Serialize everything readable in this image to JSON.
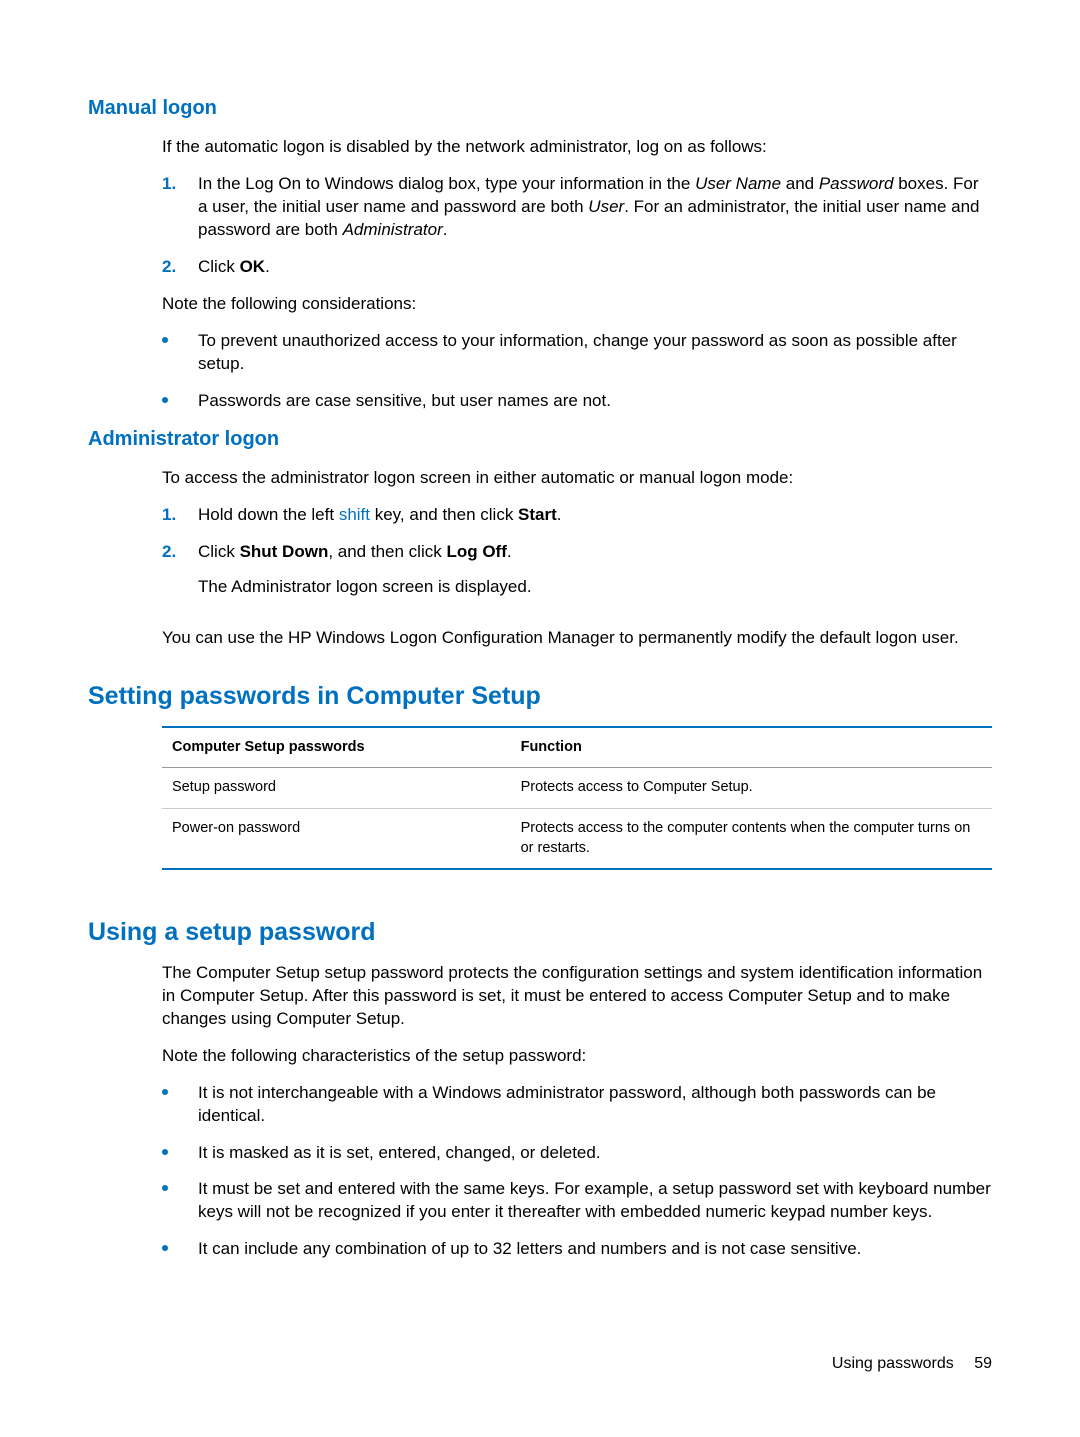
{
  "sections": {
    "manual_logon": {
      "heading": "Manual logon",
      "intro": "If the automatic logon is disabled by the network administrator, log on as follows:",
      "step1_pre": "In the Log On to Windows dialog box, type your information in the ",
      "step1_em1": "User Name",
      "step1_mid1": " and ",
      "step1_em2": "Password",
      "step1_mid2": " boxes. For a user, the initial user name and password are both ",
      "step1_em3": "User",
      "step1_mid3": ". For an administrator, the initial user name and password are both ",
      "step1_em4": "Administrator",
      "step1_end": ".",
      "step2_pre": "Click ",
      "step2_b": "OK",
      "step2_end": ".",
      "note_intro": "Note the following considerations:",
      "bullet1": "To prevent unauthorized access to your information, change your password as soon as possible after setup.",
      "bullet2": "Passwords are case sensitive, but user names are not."
    },
    "admin_logon": {
      "heading": "Administrator logon",
      "intro": "To access the administrator logon screen in either automatic or manual logon mode:",
      "step1_pre": "Hold down the left ",
      "step1_key": "shift",
      "step1_mid": " key, and then click ",
      "step1_b": "Start",
      "step1_end": ".",
      "step2_pre": "Click ",
      "step2_b1": "Shut Down",
      "step2_mid": ", and then click ",
      "step2_b2": "Log Off",
      "step2_end": ".",
      "sub": "The Administrator logon screen is displayed.",
      "tail": "You can use the HP Windows Logon Configuration Manager to permanently modify the default logon user."
    },
    "setting_passwords": {
      "heading": "Setting passwords in Computer Setup",
      "table": {
        "headers": [
          "Computer Setup passwords",
          "Function"
        ],
        "rows": [
          [
            "Setup password",
            "Protects access to Computer Setup."
          ],
          [
            "Power-on password",
            "Protects access to the computer contents when the computer turns on or restarts."
          ]
        ]
      }
    },
    "using_setup_password": {
      "heading": "Using a setup password",
      "p1": "The Computer Setup setup password protects the configuration settings and system identification information in Computer Setup. After this password is set, it must be entered to access Computer Setup and to make changes using Computer Setup.",
      "p2": "Note the following characteristics of the setup password:",
      "bullets": [
        "It is not interchangeable with a Windows administrator password, although both passwords can be identical.",
        "It is masked as it is set, entered, changed, or deleted.",
        "It must be set and entered with the same keys. For example, a setup password set with keyboard number keys will not be recognized if you enter it thereafter with embedded numeric keypad number keys.",
        "It can include any combination of up to 32 letters and numbers and is not case sensitive."
      ]
    }
  },
  "markers": {
    "n1": "1.",
    "n2": "2."
  },
  "footer": {
    "label": "Using passwords",
    "page": "59"
  }
}
